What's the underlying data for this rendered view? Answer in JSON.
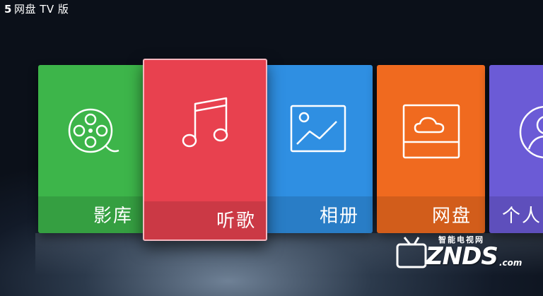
{
  "app": {
    "logo_glyph": "5",
    "title": "网盘 TV 版"
  },
  "tiles": [
    {
      "label": "影库",
      "icon": "film-reel-icon",
      "color": "#3db54a"
    },
    {
      "label": "听歌",
      "icon": "music-note-icon",
      "color": "#e8414f",
      "selected": true
    },
    {
      "label": "相册",
      "icon": "image-icon",
      "color": "#2f8fe2"
    },
    {
      "label": "网盘",
      "icon": "cloud-drive-icon",
      "color": "#f06a1f"
    },
    {
      "label": "个人",
      "icon": "user-avatar-icon",
      "color": "#6b5bd6"
    }
  ],
  "watermark": {
    "tagline": "智能电视网",
    "brand": "ZNDS",
    "suffix": ".com"
  }
}
